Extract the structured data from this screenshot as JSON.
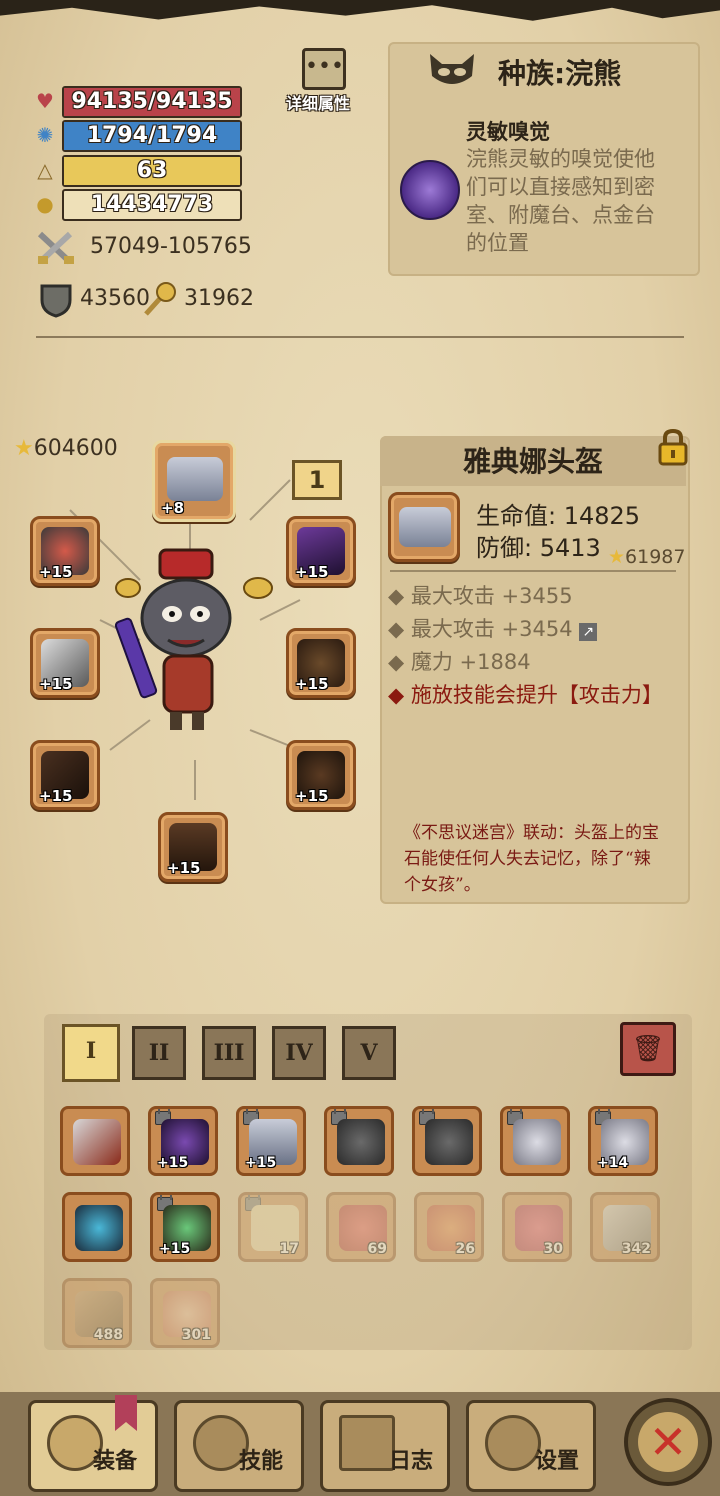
{
  "stats": {
    "hp": "94135/94135",
    "hp_fraction": 1.0,
    "mp": "1794/1794",
    "mp_fraction": 1.0,
    "level": "63",
    "level_fraction": 1.0,
    "gold": "14434773",
    "attack": "57049-105765",
    "defense": "43560",
    "magic": "31962"
  },
  "detail_button_label": "详细属性",
  "race": {
    "title": "种族:浣熊",
    "trait_name": "灵敏嗅觉",
    "trait_desc": "浣熊灵敏的嗅觉使他们可以直接感知到密室、附魔台、点金台的位置"
  },
  "power_score": "604600",
  "page_indicator": "1",
  "equipped": {
    "helmet_level": "+8",
    "slot_levels": [
      "+15",
      "+15",
      "+15",
      "+15",
      "+15",
      "+15",
      "+15"
    ]
  },
  "item_detail": {
    "name": "雅典娜头盔",
    "hp_line": "生命值: 14825",
    "def_line": "防御: 5413",
    "score": "61987",
    "attrs": [
      "最大攻击 +3455",
      "最大攻击 +3454",
      "魔力 +1884"
    ],
    "special": "施放技能会提升【攻击力】",
    "lore": "《不思议迷宫》联动：头盔上的宝石能使任何人失去记忆，除了“辣个女孩”。"
  },
  "inventory_tabs": [
    "I",
    "II",
    "III",
    "IV",
    "V"
  ],
  "inventory": {
    "row1": [
      "",
      "+15",
      "+15",
      "",
      "",
      "",
      "+14"
    ],
    "row2_counts": [
      "",
      "+15",
      "17",
      "69",
      "26",
      "30",
      "342"
    ],
    "row3_counts": [
      "488",
      "301"
    ]
  },
  "nav": {
    "equip": "装备",
    "skill": "技能",
    "log": "日志",
    "settings": "设置"
  },
  "colors": {
    "hp": "#b9434a",
    "mp": "#3f83c6",
    "level": "#e8c85a",
    "gold": "#eee0b8",
    "accent_red": "#8b1a10"
  }
}
